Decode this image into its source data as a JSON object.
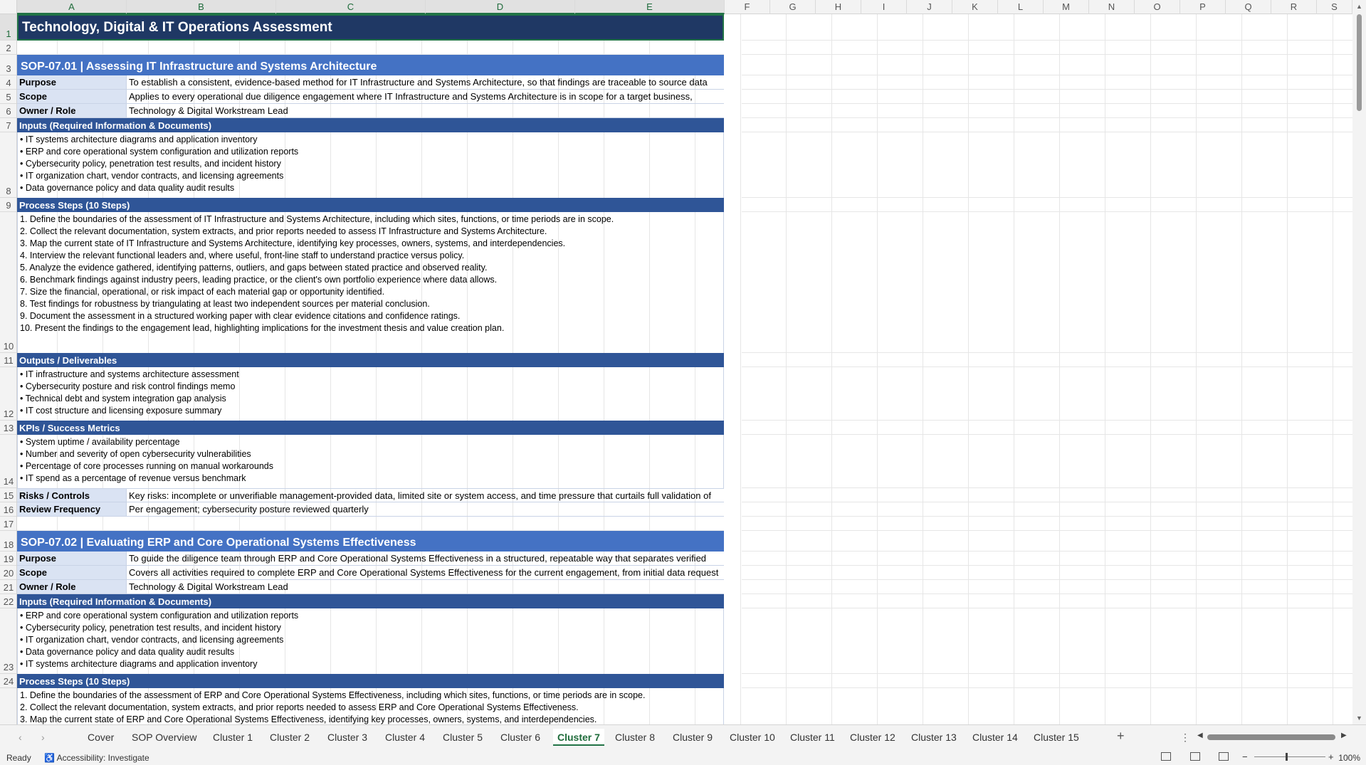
{
  "columns": [
    "A",
    "B",
    "C",
    "D",
    "E",
    "F",
    "G",
    "H",
    "I",
    "J",
    "K",
    "L",
    "M",
    "N",
    "O",
    "P",
    "Q",
    "R",
    "S"
  ],
  "rows": [
    "1",
    "2",
    "3",
    "4",
    "5",
    "6",
    "7",
    "8",
    "9",
    "10",
    "11",
    "12",
    "13",
    "14",
    "15",
    "16",
    "17",
    "18",
    "19",
    "20",
    "21",
    "22",
    "23",
    "24"
  ],
  "title": "Technology, Digital & IT Operations Assessment",
  "sop1": {
    "heading": "SOP-07.01  |  Assessing IT Infrastructure and Systems Architecture",
    "purpose_label": "Purpose",
    "purpose": "To establish a consistent, evidence-based method for IT Infrastructure and Systems Architecture, so that findings are traceable to source data",
    "scope_label": "Scope",
    "scope": "Applies to every operational due diligence engagement where IT Infrastructure and Systems Architecture is in scope for a target business,",
    "owner_label": "Owner / Role",
    "owner": "Technology & Digital Workstream Lead",
    "inputs_label": "Inputs (Required Information & Documents)",
    "inputs": [
      "• IT systems architecture diagrams and application inventory",
      "• ERP and core operational system configuration and utilization reports",
      "• Cybersecurity policy, penetration test results, and incident history",
      "• IT organization chart, vendor contracts, and licensing agreements",
      "• Data governance policy and data quality audit results"
    ],
    "steps_label": "Process Steps (10 Steps)",
    "steps": [
      "1. Define the boundaries of the assessment of IT Infrastructure and Systems Architecture, including which sites, functions, or time periods are in scope.",
      "2. Collect the relevant documentation, system extracts, and prior reports needed to assess IT Infrastructure and Systems Architecture.",
      "3. Map the current state of IT Infrastructure and Systems Architecture, identifying key processes, owners, systems, and interdependencies.",
      "4. Interview the relevant functional leaders and, where useful, front-line staff to understand practice versus policy.",
      "5. Analyze the evidence gathered, identifying patterns, outliers, and gaps between stated practice and observed reality.",
      "6. Benchmark findings against industry peers, leading practice, or the client's own portfolio experience where data allows.",
      "7. Size the financial, operational, or risk impact of each material gap or opportunity identified.",
      "8. Test findings for robustness by triangulating at least two independent sources per material conclusion.",
      "9. Document the assessment in a structured working paper with clear evidence citations and confidence ratings.",
      "10. Present the findings to the engagement lead, highlighting implications for the investment thesis and value creation plan."
    ],
    "outputs_label": "Outputs / Deliverables",
    "outputs": [
      "• IT infrastructure and systems architecture assessment",
      "• Cybersecurity posture and risk control findings memo",
      "• Technical debt and system integration gap analysis",
      "• IT cost structure and licensing exposure summary"
    ],
    "kpis_label": "KPIs / Success Metrics",
    "kpis": [
      "• System uptime / availability percentage",
      "• Number and severity of open cybersecurity vulnerabilities",
      "• Percentage of core processes running on manual workarounds",
      "• IT spend as a percentage of revenue versus benchmark"
    ],
    "risks_label": "Risks / Controls",
    "risks": "Key risks: incomplete or unverifiable management-provided data, limited site or system access, and time pressure that curtails full validation of",
    "review_label": "Review Frequency",
    "review": "Per engagement; cybersecurity posture reviewed quarterly"
  },
  "sop2": {
    "heading": "SOP-07.02  |  Evaluating ERP and Core Operational Systems Effectiveness",
    "purpose_label": "Purpose",
    "purpose": "To guide the diligence team through ERP and Core Operational Systems Effectiveness in a structured, repeatable way that separates verified",
    "scope_label": "Scope",
    "scope": "Covers all activities required to complete ERP and Core Operational Systems Effectiveness for the current engagement, from initial data request",
    "owner_label": "Owner / Role",
    "owner": "Technology & Digital Workstream Lead",
    "inputs_label": "Inputs (Required Information & Documents)",
    "inputs": [
      "• ERP and core operational system configuration and utilization reports",
      "• Cybersecurity policy, penetration test results, and incident history",
      "• IT organization chart, vendor contracts, and licensing agreements",
      "• Data governance policy and data quality audit results",
      "• IT systems architecture diagrams and application inventory"
    ],
    "steps_label": "Process Steps (10 Steps)",
    "steps": [
      "1. Define the boundaries of the assessment of ERP and Core Operational Systems Effectiveness, including which sites, functions, or time periods are in scope.",
      "2. Collect the relevant documentation, system extracts, and prior reports needed to assess ERP and Core Operational Systems Effectiveness.",
      "3. Map the current state of ERP and Core Operational Systems Effectiveness, identifying key processes, owners, systems, and interdependencies."
    ]
  },
  "tabs": [
    "Cover",
    "SOP Overview",
    "Cluster 1",
    "Cluster 2",
    "Cluster 3",
    "Cluster 4",
    "Cluster 5",
    "Cluster 6",
    "Cluster 7",
    "Cluster 8",
    "Cluster 9",
    "Cluster 10",
    "Cluster 11",
    "Cluster 12",
    "Cluster 13",
    "Cluster 14",
    "Cluster 15"
  ],
  "active_tab": "Cluster 7",
  "status": {
    "ready": "Ready",
    "accessibility": "Accessibility: Investigate",
    "zoom": "100%"
  },
  "colors": {
    "title_bg": "#1f3864",
    "sop_bg": "#4472c4",
    "section_bg": "#2f5597",
    "label_bg": "#dae3f3",
    "accent": "#217346"
  }
}
